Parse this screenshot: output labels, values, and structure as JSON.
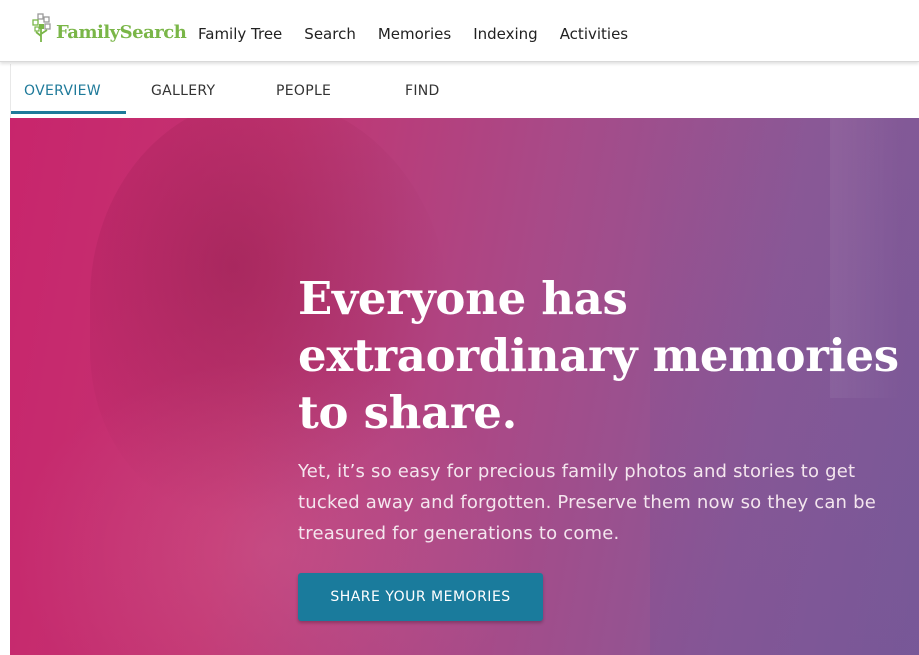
{
  "header": {
    "logo_text": "FamilySearch",
    "nav": [
      {
        "label": "Family Tree"
      },
      {
        "label": "Search"
      },
      {
        "label": "Memories"
      },
      {
        "label": "Indexing"
      },
      {
        "label": "Activities"
      }
    ]
  },
  "tabs": [
    {
      "label": "OVERVIEW",
      "active": true
    },
    {
      "label": "GALLERY",
      "active": false
    },
    {
      "label": "PEOPLE",
      "active": false
    },
    {
      "label": "FIND",
      "active": false
    }
  ],
  "hero": {
    "title_line1": "Everyone has",
    "title_line2": "extraordinary memories",
    "title_line3": "to share.",
    "text": "Yet, it’s so easy for precious family photos and stories to get tucked away and forgotten. Preserve them now so they can be treasured for generations to come.",
    "cta_label": "SHARE YOUR MEMORIES"
  },
  "colors": {
    "brand_green": "#7ab648",
    "accent_teal": "#1f7a9a",
    "hero_magenta": "#c8256c",
    "hero_purple": "#7a5a98"
  }
}
